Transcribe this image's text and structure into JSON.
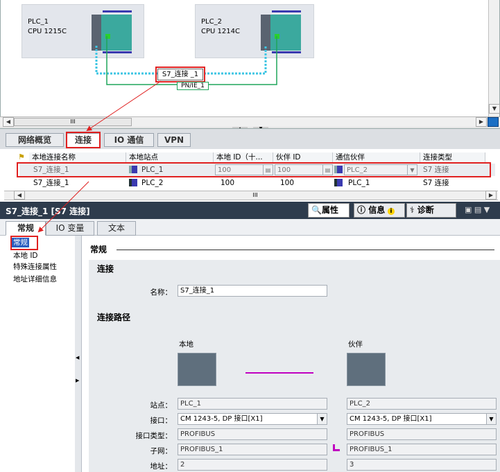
{
  "network": {
    "plc1": {
      "name": "PLC_1",
      "cpu": "CPU 1215C"
    },
    "plc2": {
      "name": "PLC_2",
      "cpu": "CPU 1214C"
    },
    "connection_label": "S7_连接 _1",
    "subnet_label": "PN/IE_1",
    "scroll_thumb": "III"
  },
  "tabs": [
    "网络概览",
    "连接",
    "IO 通信",
    "VPN"
  ],
  "table": {
    "headers": [
      "本地连接名称",
      "本地站点",
      "本地 ID（十...",
      "伙伴 ID",
      "通信伙伴",
      "连接类型"
    ],
    "rows": [
      {
        "name": "S7_连接_1",
        "station": "PLC_1",
        "local_id": "100",
        "partner_id": "100",
        "partner": "PLC_2",
        "type": "S7 连接"
      },
      {
        "name": "S7_连接_1",
        "station": "PLC_2",
        "local_id": "100",
        "partner_id": "100",
        "partner": "PLC_1",
        "type": "S7 连接"
      }
    ],
    "scroll_thumb": "III"
  },
  "inspector": {
    "title": "S7_连接_1 [S7 连接]",
    "tabs": {
      "properties": "属性",
      "info": "信息",
      "diagnostics": "诊断"
    },
    "subtabs": [
      "常规",
      "IO 变量",
      "文本"
    ],
    "nav": [
      "常规",
      "本地 ID",
      "特殊连接属性",
      "地址详细信息"
    ],
    "section_title": "常规",
    "group_connection": "连接",
    "name_label": "名称：",
    "name_value": "S7_连接_1",
    "group_path": "连接路径",
    "local_header": "本地",
    "partner_header": "伙伴",
    "station_label": "站点：",
    "interface_label": "接口：",
    "iftype_label": "接口类型：",
    "subnet_label": "子网：",
    "address_label": "地址：",
    "local": {
      "station": "PLC_1",
      "interface": "CM 1243-5, DP 接口[X1]",
      "iftype": "PROFIBUS",
      "subnet": "PROFIBUS_1",
      "address": "2"
    },
    "partner": {
      "station": "PLC_2",
      "interface": "CM 1243-5, DP 接口[X1]",
      "iftype": "PROFIBUS",
      "subnet": "PROFIBUS_1",
      "address": "3"
    }
  }
}
